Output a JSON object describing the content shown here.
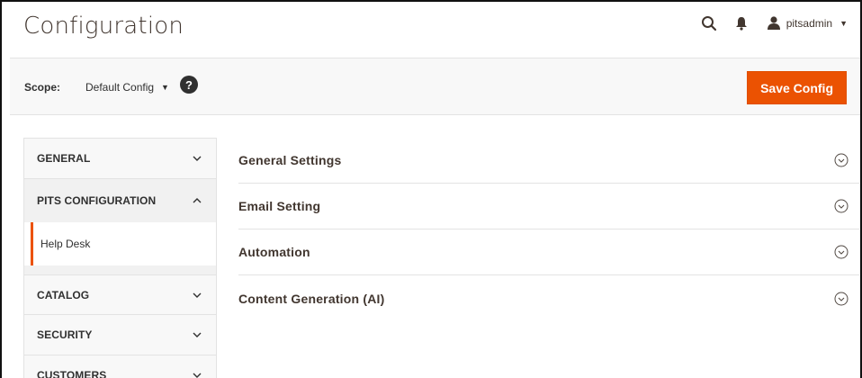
{
  "header": {
    "title": "Configuration",
    "search_icon": "search-icon",
    "notifications_icon": "bell-icon",
    "user": {
      "icon": "user-icon",
      "name": "pitsadmin"
    }
  },
  "scope": {
    "label": "Scope:",
    "value": "Default Config",
    "help_icon": "question-icon",
    "help_glyph": "?"
  },
  "actions": {
    "save_label": "Save Config"
  },
  "sidebar": {
    "sections": [
      {
        "label": "GENERAL",
        "state": "collapsed"
      },
      {
        "label": "PITS CONFIGURATION",
        "state": "expanded",
        "items": [
          {
            "label": "Help Desk",
            "active": true
          }
        ]
      },
      {
        "label": "CATALOG",
        "state": "collapsed"
      },
      {
        "label": "SECURITY",
        "state": "collapsed"
      },
      {
        "label": "CUSTOMERS",
        "state": "collapsed"
      }
    ]
  },
  "content": {
    "groups": [
      {
        "title": "General Settings"
      },
      {
        "title": "Email Setting"
      },
      {
        "title": "Automation"
      },
      {
        "title": "Content Generation (AI)"
      }
    ]
  },
  "colors": {
    "accent": "#eb5202",
    "text": "#303030",
    "panel": "#f8f8f8",
    "border": "#e3e3e3"
  }
}
